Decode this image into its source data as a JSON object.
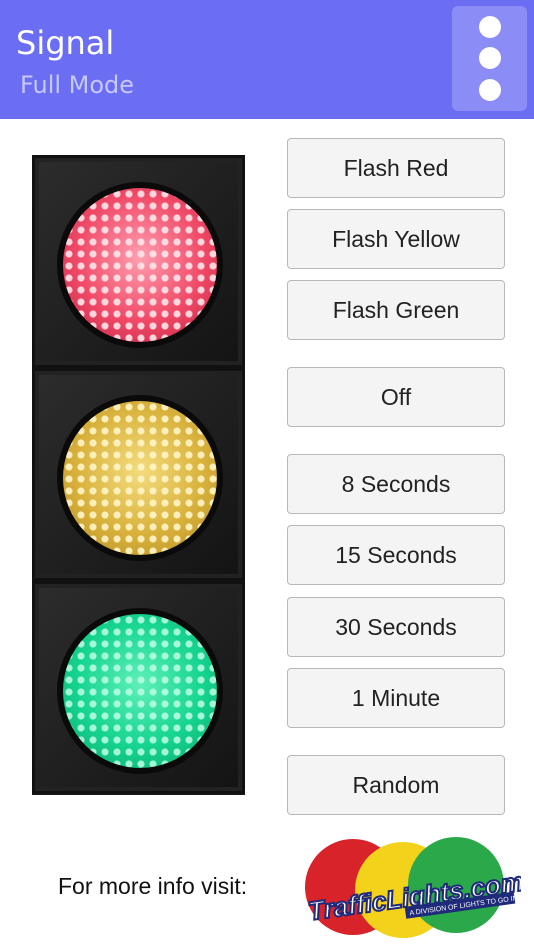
{
  "header": {
    "title": "Signal",
    "subtitle": "Full Mode",
    "menu_icon": "vertical-dots-icon",
    "background": "#6b6df2"
  },
  "signal": {
    "lamps": [
      {
        "name": "red",
        "color": "#f04a68"
      },
      {
        "name": "yellow",
        "color": "#d9b23d"
      },
      {
        "name": "green",
        "color": "#15d48d"
      }
    ]
  },
  "buttons": {
    "flash_red": "Flash Red",
    "flash_yellow": "Flash Yellow",
    "flash_green": "Flash Green",
    "off": "Off",
    "eight_seconds": "8 Seconds",
    "fifteen_seconds": "15 Seconds",
    "thirty_seconds": "30 Seconds",
    "one_minute": "1 Minute",
    "random": "Random"
  },
  "footer": {
    "info_text": "For more info visit:",
    "logo_text": "TrafficLights.com",
    "logo_tagline": "A DIVISION OF LIGHTS TO GO INC."
  }
}
